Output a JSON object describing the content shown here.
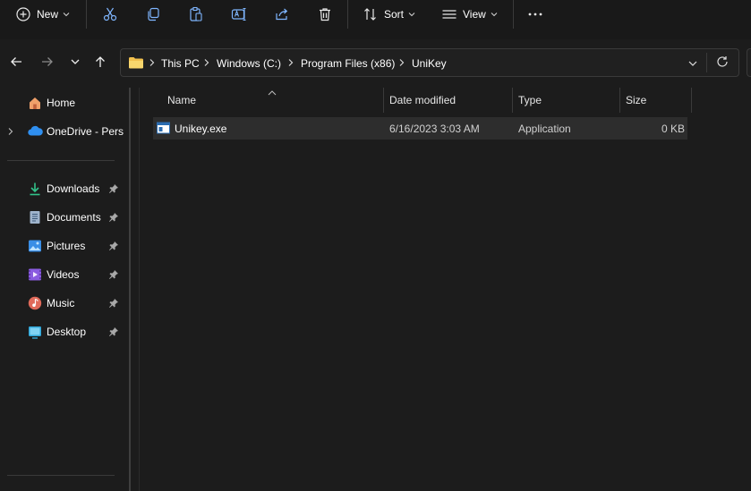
{
  "toolbar": {
    "new_label": "New",
    "sort_label": "Sort",
    "view_label": "View",
    "icons": [
      "plus-circle-icon",
      "cut-icon",
      "copy-icon",
      "paste-icon",
      "rename-icon",
      "share-icon",
      "delete-icon",
      "sort-icon",
      "view-icon",
      "more-icon"
    ]
  },
  "address": {
    "crumbs": [
      "This PC",
      "Windows (C:)",
      "Program Files (x86)",
      "UniKey"
    ]
  },
  "sidebar": {
    "home": "Home",
    "onedrive": "OneDrive - Perso",
    "quick": [
      "Downloads",
      "Documents",
      "Pictures",
      "Videos",
      "Music",
      "Desktop"
    ]
  },
  "columns": [
    "Name",
    "Date modified",
    "Type",
    "Size"
  ],
  "files": [
    {
      "name": "Unikey.exe",
      "date": "6/16/2023 3:03 AM",
      "type": "Application",
      "size": "0 KB"
    }
  ],
  "colors": {
    "background": "#1c1c1c",
    "selection": "#2d2d2d",
    "folder": "#f2c14e",
    "accent": "#4cc2ff"
  }
}
